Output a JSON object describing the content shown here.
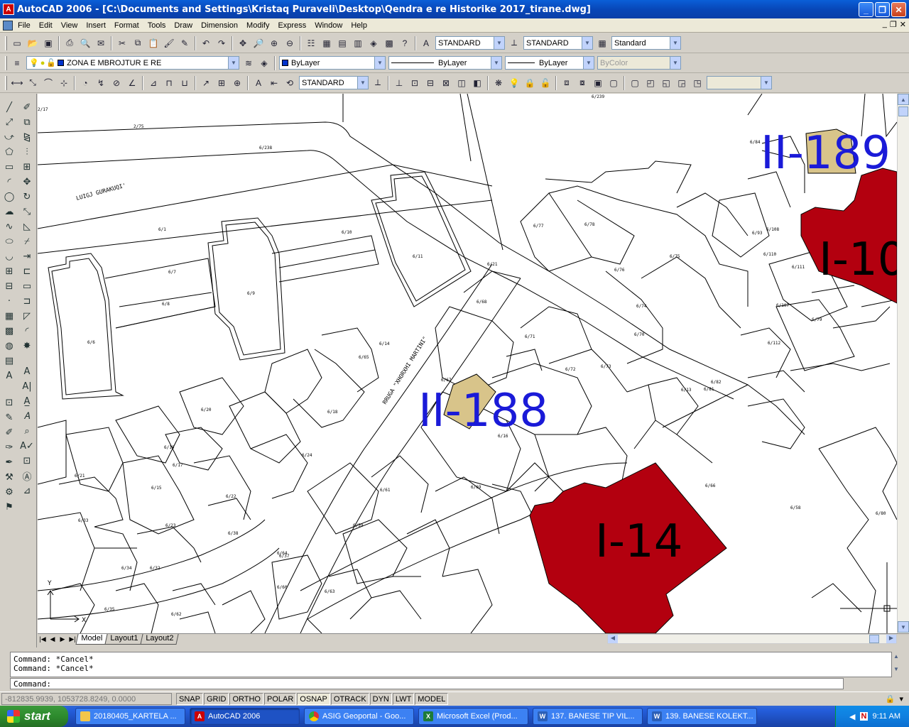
{
  "window": {
    "title": "AutoCAD 2006 - [C:\\Documents and Settings\\Kristaq Puraveli\\Desktop\\Qendra e re Historike 2017_tirane.dwg]",
    "app_icon": "autocad-icon"
  },
  "menu": [
    "File",
    "Edit",
    "View",
    "Insert",
    "Format",
    "Tools",
    "Draw",
    "Dimension",
    "Modify",
    "Express",
    "Window",
    "Help"
  ],
  "toolbar1": {
    "text_style": "STANDARD",
    "dim_style": "STANDARD",
    "table_style": "Standard"
  },
  "toolbar2": {
    "layer": "ZONA E MBROJTUR E RE",
    "color": "ByLayer",
    "linetype": "ByLayer",
    "lineweight": "ByLayer",
    "plotstyle": "ByColor"
  },
  "toolbar3": {
    "dim_style": "STANDARD"
  },
  "drawing": {
    "labels": [
      "II-189",
      "I-10",
      "II-188",
      "I-14"
    ],
    "street_labels": [
      "LUIGJ GURAKUQI'",
      "RRUGA \"XHORXHI MARTINI\""
    ],
    "parcels": [
      "2/17",
      "2/75",
      "6/239",
      "6/238",
      "6/1",
      "6/10",
      "6/11",
      "6/7",
      "6/8",
      "6/6",
      "6/9",
      "6/21",
      "6/68",
      "6/77",
      "6/78",
      "6/76",
      "6/75",
      "6/74",
      "6/70",
      "6/71",
      "6/72",
      "6/73",
      "6/13",
      "6/14",
      "6/65",
      "6/67",
      "6/16",
      "6/18",
      "6/20",
      "6/19",
      "6/17",
      "6/24",
      "6/21",
      "6/15",
      "6/22",
      "6/23",
      "6/33",
      "6/34",
      "6/32",
      "6/35",
      "6/62",
      "6/64",
      "6/60",
      "6/61",
      "6/59",
      "6/63",
      "6/37",
      "6/38",
      "6/69",
      "6/66",
      "6/58",
      "6/80",
      "6/81",
      "6/82",
      "6/84",
      "6/93",
      "6/110",
      "6/108",
      "6/111",
      "6/107",
      "6/112",
      "6/79"
    ]
  },
  "tabs": [
    "Model",
    "Layout1",
    "Layout2"
  ],
  "command": {
    "history": [
      "Command:  *Cancel*",
      "Command:  *Cancel*"
    ],
    "prompt": "Command:"
  },
  "status": {
    "coords": "-812835.9939, 1053728.8249, 0.0000",
    "toggles": [
      "SNAP",
      "GRID",
      "ORTHO",
      "POLAR",
      "OSNAP",
      "OTRACK",
      "DYN",
      "LWT",
      "MODEL"
    ]
  },
  "taskbar": {
    "start": "start",
    "tasks": [
      {
        "label": "20180405_KARTELA ...",
        "icon": "folder-icon"
      },
      {
        "label": "AutoCAD 2006",
        "icon": "autocad-icon"
      },
      {
        "label": "ASIG Geoportal - Goo...",
        "icon": "chrome-icon"
      },
      {
        "label": "Microsoft Excel (Prod...",
        "icon": "excel-icon"
      },
      {
        "label": "137. BANESE TIP VIL...",
        "icon": "word-icon"
      },
      {
        "label": "139. BANESE KOLEKT...",
        "icon": "word-icon"
      }
    ],
    "clock": "9:11 AM"
  },
  "colors": {
    "monument_red": "#b3000f",
    "monument_tan": "#d8c48a",
    "label_blue": "#1a1ad8"
  }
}
